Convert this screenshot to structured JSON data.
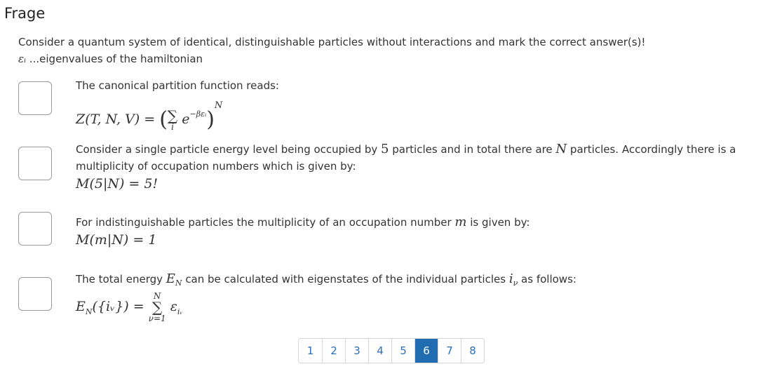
{
  "header": {
    "title": "Frage"
  },
  "question": {
    "prompt": "Consider a quantum system of identical, distinguishable particles without interactions and mark the correct answer(s)!",
    "epsilon_symbol": "εᵢ",
    "epsilon_desc": " ...eigenvalues of the hamiltonian"
  },
  "options": [
    {
      "text": "The canonical partition function reads:",
      "formula_lhs": "Z(T, N, V) = ",
      "formula_exp": "−βεᵢ",
      "formula_outer_exp": "N",
      "formula_sub": "i"
    },
    {
      "text_a": "Consider a single particle energy level being occupied by ",
      "num": "5",
      "text_b": " particles and in total there are ",
      "var": "N",
      "text_c": " particles. Accordingly there is a multiplicity of occupation numbers which is given by:",
      "formula": "M(5|N) = 5!"
    },
    {
      "text_a": "For indistinguishable particles the multiplicity of an occupation number ",
      "var": "m",
      "text_b": " is given by:",
      "formula": "M(m|N) = 1"
    },
    {
      "text_a": "The total energy ",
      "var": "E",
      "var_sub": "N",
      "text_b": " can be calculated with eigenstates of the individual particles ",
      "var2": "i",
      "var2_sub": "ν",
      "text_c": " as follows:",
      "formula_lhs": "E",
      "formula_lhs_sub": "N",
      "formula_mid": "({iᵥ}) = ",
      "sum_top": "N",
      "sum_bottom": "ν=1",
      "sum_term": "ε",
      "sum_term_sub": "iᵥ"
    }
  ],
  "pagination": {
    "pages": [
      "1",
      "2",
      "3",
      "4",
      "5",
      "6",
      "7",
      "8"
    ],
    "current": "6"
  }
}
